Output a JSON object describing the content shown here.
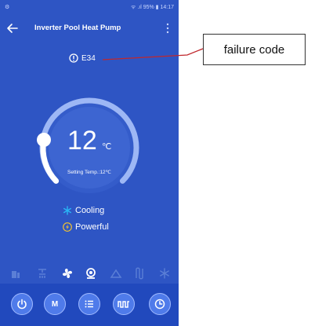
{
  "status_bar": {
    "left": "⚙",
    "right": "ᯤ .ıl 95% ▮ 14:17"
  },
  "app_bar": {
    "title": "Inverter Pool Heat Pump"
  },
  "fault": {
    "code": "E34"
  },
  "thermostat": {
    "current_temp": "12",
    "unit": "℃",
    "setting_label": "Setting Temp.:12℃"
  },
  "modes": [
    {
      "label": "Cooling",
      "icon": "snowflake-icon",
      "color": "#29b6f6"
    },
    {
      "label": "Powerful",
      "icon": "lightning-icon",
      "color": "#f2c230"
    }
  ],
  "bottom_bar": {
    "buttons": [
      {
        "label": "",
        "icon": "power-icon"
      },
      {
        "label": "M",
        "icon": "mode-icon"
      },
      {
        "label": "",
        "icon": "list-icon"
      },
      {
        "label": "",
        "icon": "timer-schedule-icon"
      },
      {
        "label": "",
        "icon": "clock-icon"
      }
    ]
  },
  "callout": {
    "label": "failure code"
  },
  "colors": {
    "background": "#2e55c4",
    "bar": "#2149bd",
    "button": "#4f7bea",
    "callout_line": "#c0282d"
  }
}
